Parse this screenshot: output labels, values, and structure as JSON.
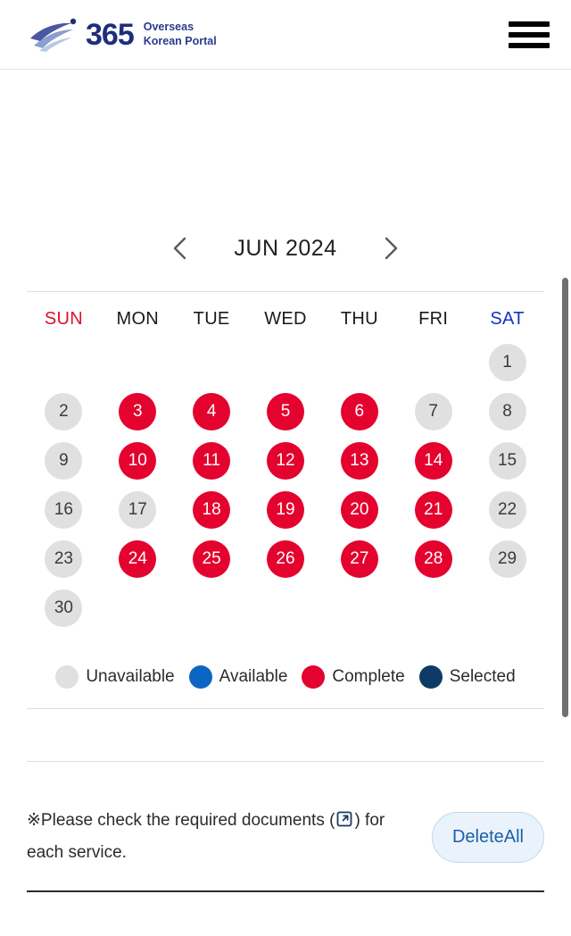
{
  "header": {
    "logo": {
      "mark": "globe-swoosh-icon",
      "number": "365",
      "line1": "Overseas",
      "line2": "Korean Portal"
    },
    "menu_icon": "hamburger-menu-icon"
  },
  "calendar": {
    "prev_icon": "chevron-left-icon",
    "next_icon": "chevron-right-icon",
    "month_label": "JUN 2024",
    "weekdays": [
      {
        "label": "SUN",
        "tone": "sun"
      },
      {
        "label": "MON",
        "tone": ""
      },
      {
        "label": "TUE",
        "tone": ""
      },
      {
        "label": "WED",
        "tone": ""
      },
      {
        "label": "THU",
        "tone": ""
      },
      {
        "label": "FRI",
        "tone": ""
      },
      {
        "label": "SAT",
        "tone": "sat"
      }
    ],
    "weeks": [
      [
        {
          "label": "",
          "state": "empty"
        },
        {
          "label": "",
          "state": "empty"
        },
        {
          "label": "",
          "state": "empty"
        },
        {
          "label": "",
          "state": "empty"
        },
        {
          "label": "",
          "state": "empty"
        },
        {
          "label": "",
          "state": "empty"
        },
        {
          "label": "1",
          "state": "unavailable"
        }
      ],
      [
        {
          "label": "2",
          "state": "unavailable"
        },
        {
          "label": "3",
          "state": "complete"
        },
        {
          "label": "4",
          "state": "complete"
        },
        {
          "label": "5",
          "state": "complete"
        },
        {
          "label": "6",
          "state": "complete"
        },
        {
          "label": "7",
          "state": "unavailable"
        },
        {
          "label": "8",
          "state": "unavailable"
        }
      ],
      [
        {
          "label": "9",
          "state": "unavailable"
        },
        {
          "label": "10",
          "state": "complete"
        },
        {
          "label": "11",
          "state": "complete"
        },
        {
          "label": "12",
          "state": "complete"
        },
        {
          "label": "13",
          "state": "complete"
        },
        {
          "label": "14",
          "state": "complete"
        },
        {
          "label": "15",
          "state": "unavailable"
        }
      ],
      [
        {
          "label": "16",
          "state": "unavailable"
        },
        {
          "label": "17",
          "state": "unavailable"
        },
        {
          "label": "18",
          "state": "complete"
        },
        {
          "label": "19",
          "state": "complete"
        },
        {
          "label": "20",
          "state": "complete"
        },
        {
          "label": "21",
          "state": "complete"
        },
        {
          "label": "22",
          "state": "unavailable"
        }
      ],
      [
        {
          "label": "23",
          "state": "unavailable"
        },
        {
          "label": "24",
          "state": "complete"
        },
        {
          "label": "25",
          "state": "complete"
        },
        {
          "label": "26",
          "state": "complete"
        },
        {
          "label": "27",
          "state": "complete"
        },
        {
          "label": "28",
          "state": "complete"
        },
        {
          "label": "29",
          "state": "unavailable"
        }
      ],
      [
        {
          "label": "30",
          "state": "unavailable"
        },
        {
          "label": "",
          "state": "empty"
        },
        {
          "label": "",
          "state": "empty"
        },
        {
          "label": "",
          "state": "empty"
        },
        {
          "label": "",
          "state": "empty"
        },
        {
          "label": "",
          "state": "empty"
        },
        {
          "label": "",
          "state": "empty"
        }
      ]
    ]
  },
  "legend": [
    {
      "label": "Unavailable",
      "color": "#e0e0e0"
    },
    {
      "label": "Available",
      "color": "#0b66c3"
    },
    {
      "label": "Complete",
      "color": "#e4032e"
    },
    {
      "label": "Selected",
      "color": "#0e3a66"
    }
  ],
  "notice": {
    "text_before": "※Please check the required documents (",
    "link_icon": "external-link-icon",
    "text_after": ") for each service.",
    "delete_all_label": "DeleteAll"
  },
  "colors": {
    "brand_navy": "#1f2e7a",
    "complete_red": "#e4032e",
    "available_blue": "#0b66c3",
    "selected_navy": "#0e3a66",
    "unavailable_gray": "#e0e0e0",
    "sunday_red": "#e01029",
    "saturday_blue": "#1630c8",
    "button_blue": "#1c5fa8"
  }
}
